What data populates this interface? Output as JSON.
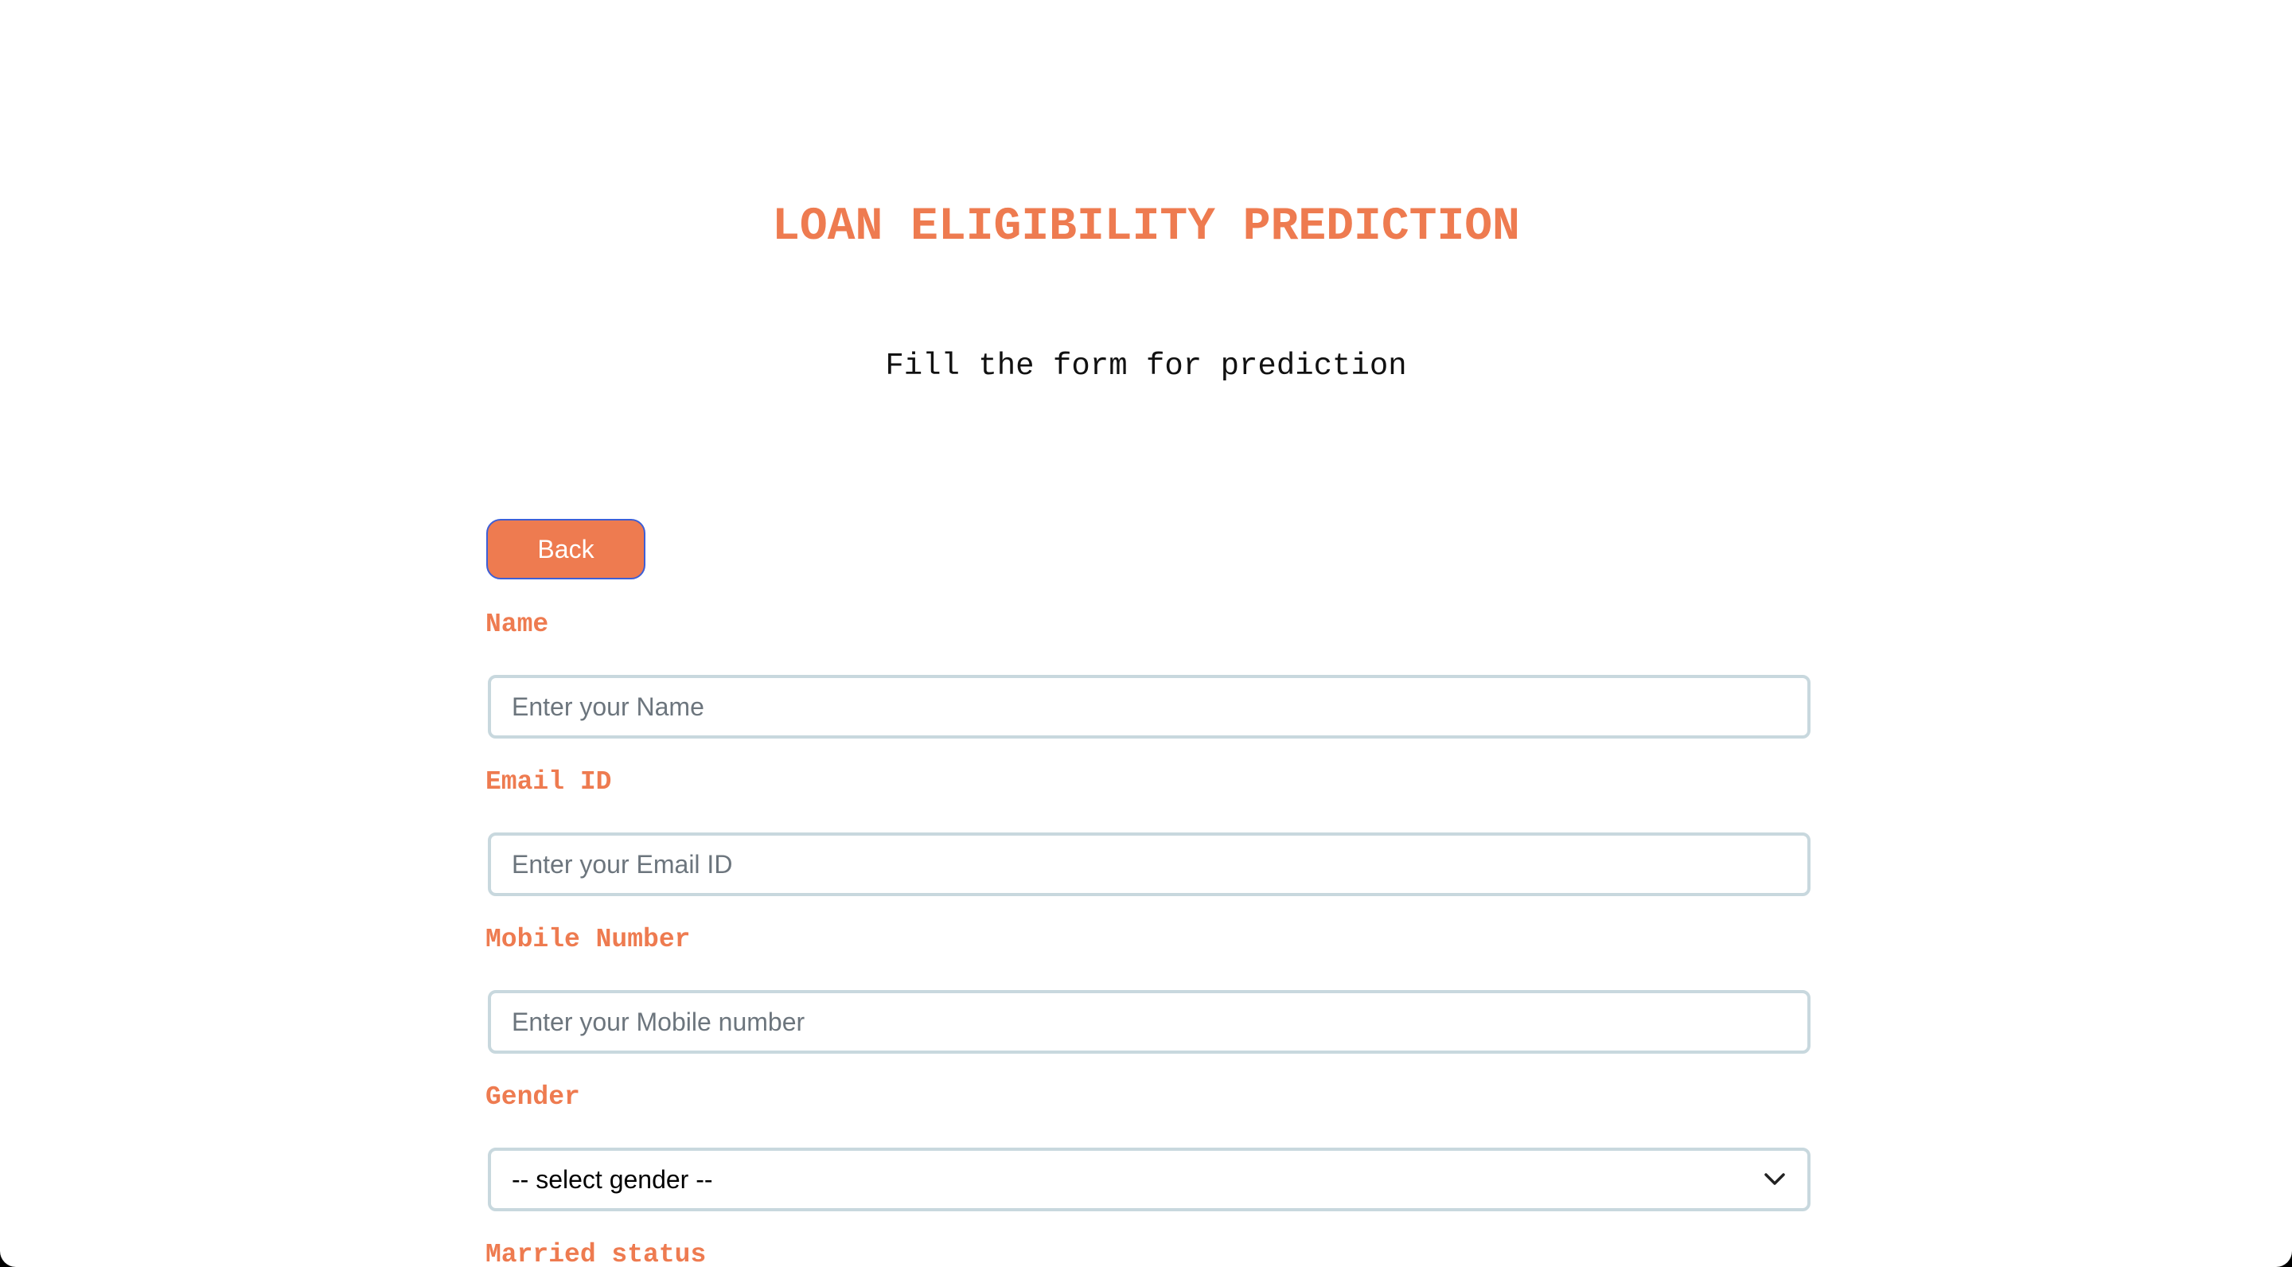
{
  "header": {
    "title": "LOAN ELIGIBILITY PREDICTION",
    "subtitle": "Fill the form for prediction"
  },
  "actions": {
    "back_label": "Back"
  },
  "form": {
    "name": {
      "label": "Name",
      "placeholder": "Enter your Name",
      "value": ""
    },
    "email": {
      "label": "Email ID",
      "placeholder": "Enter your Email ID",
      "value": ""
    },
    "mobile": {
      "label": "Mobile Number",
      "placeholder": "Enter your Mobile number",
      "value": ""
    },
    "gender": {
      "label": "Gender",
      "selected": "-- select gender --",
      "icon": "chevron-down-icon"
    },
    "married": {
      "label": "Married status"
    }
  },
  "theme": {
    "accent": "#ee7b50",
    "button_border": "#3d5fd6",
    "input_border": "#c8d8de"
  }
}
